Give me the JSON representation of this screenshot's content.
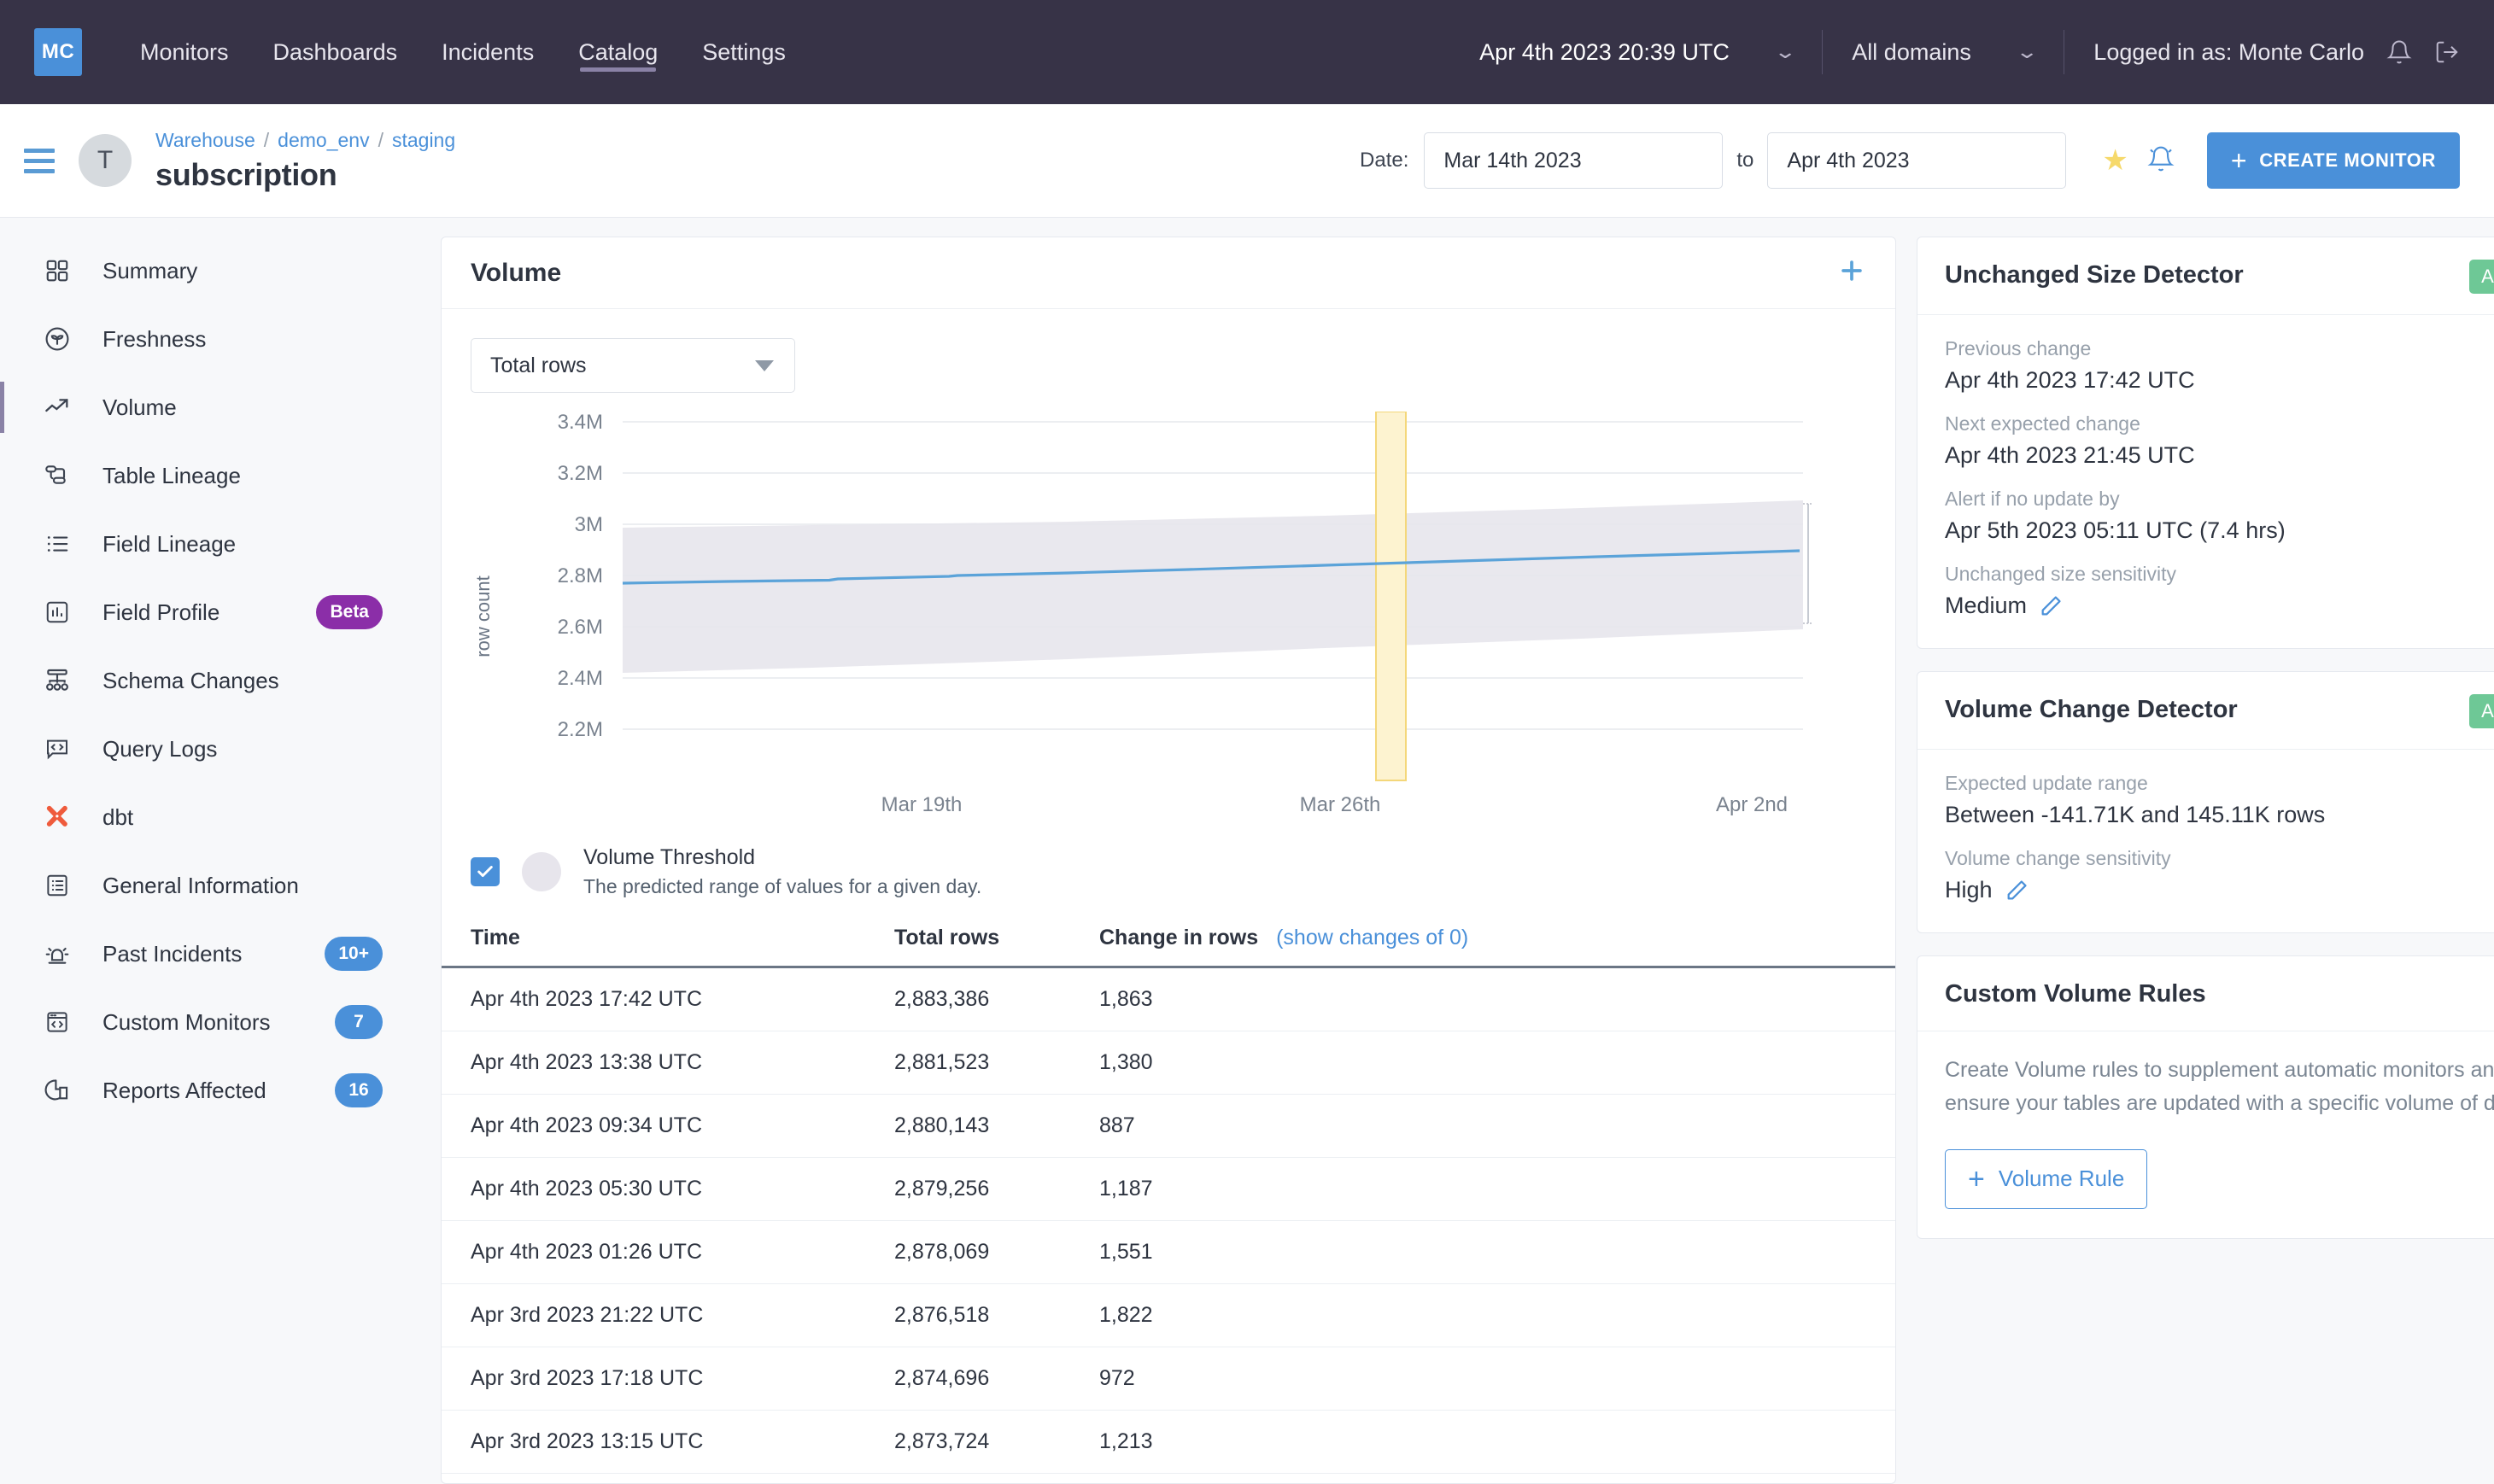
{
  "topnav": {
    "logo": "MC",
    "links": [
      {
        "label": "Monitors",
        "active": false
      },
      {
        "label": "Dashboards",
        "active": false
      },
      {
        "label": "Incidents",
        "active": false
      },
      {
        "label": "Catalog",
        "active": true
      },
      {
        "label": "Settings",
        "active": false
      }
    ],
    "datetime": "Apr 4th 2023 20:39 UTC",
    "domain": "All domains",
    "user": "Logged in as: Monte Carlo",
    "bell_icon": "bell-icon",
    "logout_icon": "logout-icon"
  },
  "header": {
    "avatar_initial": "T",
    "breadcrumb": [
      "Warehouse",
      "demo_env",
      "staging"
    ],
    "breadcrumb_sep": "/",
    "title": "subscription",
    "date_label": "Date:",
    "date_from": "Mar 14th 2023",
    "date_to_label": "to",
    "date_to": "Apr 4th 2023",
    "create_button": "CREATE MONITOR",
    "create_plus": "+"
  },
  "sidebar": {
    "items": [
      {
        "label": "Summary",
        "icon": "grid-icon",
        "badge": null,
        "active": false
      },
      {
        "label": "Freshness",
        "icon": "leaf-circle-icon",
        "badge": null,
        "active": false
      },
      {
        "label": "Volume",
        "icon": "trend-up-icon",
        "badge": null,
        "active": true
      },
      {
        "label": "Table Lineage",
        "icon": "table-lineage-icon",
        "badge": null,
        "active": false
      },
      {
        "label": "Field Lineage",
        "icon": "list-icon",
        "badge": null,
        "active": false
      },
      {
        "label": "Field Profile",
        "icon": "bar-chart-box-icon",
        "badge": "Beta",
        "badge_style": "beta",
        "active": false
      },
      {
        "label": "Schema Changes",
        "icon": "schema-tree-icon",
        "badge": null,
        "active": false
      },
      {
        "label": "Query Logs",
        "icon": "code-bubble-icon",
        "badge": null,
        "active": false
      },
      {
        "label": "dbt",
        "icon": "dbt-logo-icon",
        "badge": null,
        "active": false
      },
      {
        "label": "General Information",
        "icon": "document-list-icon",
        "badge": null,
        "active": false
      },
      {
        "label": "Past Incidents",
        "icon": "siren-icon",
        "badge": "10+",
        "badge_style": "blue",
        "active": false
      },
      {
        "label": "Custom Monitors",
        "icon": "browser-code-icon",
        "badge": "7",
        "badge_style": "blue",
        "active": false
      },
      {
        "label": "Reports Affected",
        "icon": "pie-report-icon",
        "badge": "16",
        "badge_style": "blue",
        "active": false
      }
    ]
  },
  "volume_card": {
    "title": "Volume",
    "add_icon": "plus-icon",
    "metric_select": "Total rows",
    "legend": {
      "checked": true,
      "title": "Volume Threshold",
      "subtitle": "The predicted range of values for a given day."
    },
    "table": {
      "columns": [
        "Time",
        "Total rows",
        "Change in rows"
      ],
      "show_changes_link": "(show changes of 0)",
      "rows": [
        {
          "time": "Apr 4th 2023 17:42 UTC",
          "total": "2,883,386",
          "change": "1,863"
        },
        {
          "time": "Apr 4th 2023 13:38 UTC",
          "total": "2,881,523",
          "change": "1,380"
        },
        {
          "time": "Apr 4th 2023 09:34 UTC",
          "total": "2,880,143",
          "change": "887"
        },
        {
          "time": "Apr 4th 2023 05:30 UTC",
          "total": "2,879,256",
          "change": "1,187"
        },
        {
          "time": "Apr 4th 2023 01:26 UTC",
          "total": "2,878,069",
          "change": "1,551"
        },
        {
          "time": "Apr 3rd 2023 21:22 UTC",
          "total": "2,876,518",
          "change": "1,822"
        },
        {
          "time": "Apr 3rd 2023 17:18 UTC",
          "total": "2,874,696",
          "change": "972"
        },
        {
          "time": "Apr 3rd 2023 13:15 UTC",
          "total": "2,873,724",
          "change": "1,213"
        }
      ]
    }
  },
  "chart_data": {
    "type": "line",
    "title": "Volume",
    "xlabel": "",
    "ylabel": "row count",
    "grid": true,
    "ylim": [
      2100000,
      3500000
    ],
    "ytick_labels": [
      "3.4M",
      "3.2M",
      "3M",
      "2.8M",
      "2.6M",
      "2.4M",
      "2.2M"
    ],
    "ytick_values": [
      3400000,
      3200000,
      3000000,
      2800000,
      2600000,
      2400000,
      2200000
    ],
    "xtick_labels": [
      "Mar 19th",
      "Mar 26th",
      "Apr 2nd"
    ],
    "x_range": [
      "Mar 14th 2023",
      "Apr 4th 2023"
    ],
    "series": [
      {
        "name": "row count",
        "color": "#5ba3d9",
        "x": [
          "Mar 14th",
          "Mar 17th",
          "Mar 19th",
          "Mar 22nd",
          "Mar 26th",
          "Mar 29th",
          "Apr 2nd",
          "Apr 4th"
        ],
        "values": [
          2712000,
          2722000,
          2732000,
          2745000,
          2762000,
          2785000,
          2808000,
          2828000
        ]
      }
    ],
    "bands": [
      {
        "name": "Volume Threshold",
        "color": "#e7e5ec",
        "description": "The predicted range of values for a given day.",
        "upper": [
          2988000,
          2992000,
          2996000,
          3002000,
          3012000,
          3026000,
          3044000,
          3060000
        ],
        "lower": [
          2430000,
          2434000,
          2438000,
          2444000,
          2452000,
          2462000,
          2474000,
          2484000
        ]
      }
    ],
    "annotations": [
      {
        "type": "vertical-highlight",
        "label": "Mar 27th",
        "color": "#f9d976",
        "fill": "#fdf3d0"
      }
    ]
  },
  "right_panels": [
    {
      "id": "unchanged-size-detector",
      "title": "Unchanged Size Detector",
      "status": "Active",
      "fields": [
        {
          "label": "Previous change",
          "value": "Apr 4th 2023 17:42 UTC",
          "editable": false
        },
        {
          "label": "Next expected change",
          "value": "Apr 4th 2023 21:45 UTC",
          "editable": false
        },
        {
          "label": "Alert if no update by",
          "value": "Apr 5th 2023 05:11 UTC (7.4 hrs)",
          "editable": false
        },
        {
          "label": "Unchanged size sensitivity",
          "value": "Medium",
          "editable": true
        }
      ]
    },
    {
      "id": "volume-change-detector",
      "title": "Volume Change Detector",
      "status": "Active",
      "fields": [
        {
          "label": "Expected update range",
          "value": "Between -141.71K and 145.11K rows",
          "editable": false
        },
        {
          "label": "Volume change sensitivity",
          "value": "High",
          "editable": true
        }
      ]
    }
  ],
  "custom_rules": {
    "title": "Custom Volume Rules",
    "description": "Create Volume rules to supplement automatic monitors and ensure your tables are updated with a specific volume of data.",
    "button": "Volume Rule",
    "button_plus": "+"
  },
  "colors": {
    "accent": "#4a90d9",
    "nav_bg": "#373347",
    "status_active": "#6ec896",
    "beta_badge": "#8b2ea8",
    "dbt_orange": "#ef5b3c",
    "chart_line": "#5ba3d9",
    "chart_band": "#e7e5ec",
    "highlight": "#f9d976"
  }
}
